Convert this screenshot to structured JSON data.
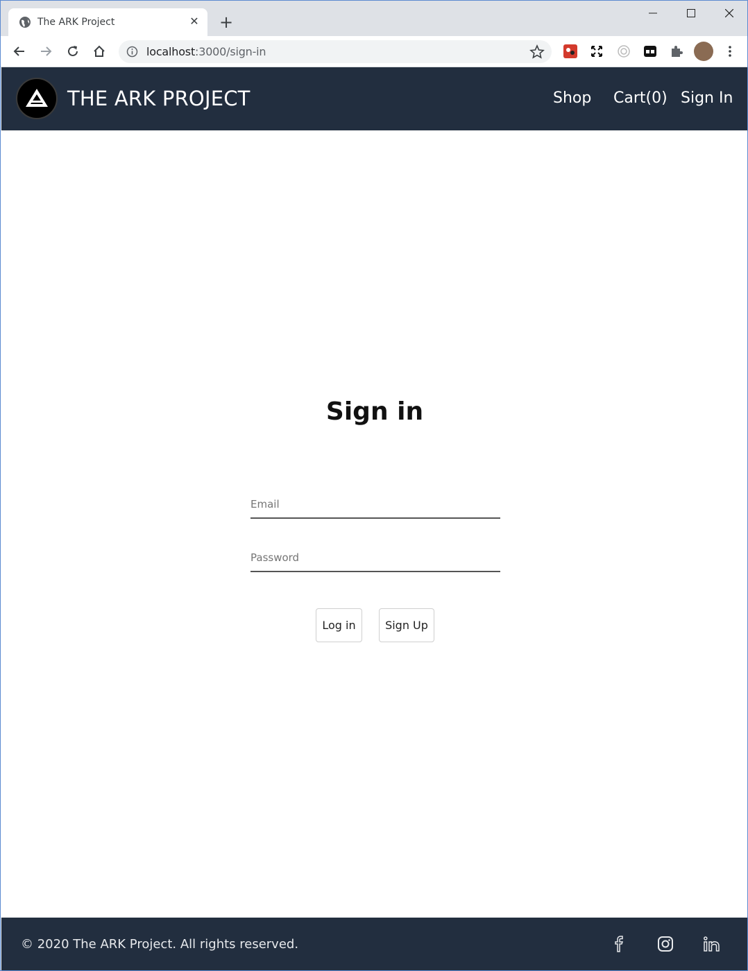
{
  "browser": {
    "tab_title": "The ARK Project",
    "tab_close": "✕",
    "new_tab": "+",
    "url_host": "localhost",
    "url_path": ":3000/sign-in"
  },
  "header": {
    "brand": "THE ARK PROJECT",
    "nav": {
      "shop": "Shop",
      "cart": "Cart(0)",
      "sign_in": "Sign In"
    }
  },
  "main": {
    "title": "Sign in",
    "email_placeholder": "Email",
    "password_placeholder": "Password",
    "login_label": "Log in",
    "signup_label": "Sign Up"
  },
  "footer": {
    "copyright": "© 2020 The ARK Project. All rights reserved.",
    "social_icons": [
      "facebook-icon",
      "instagram-icon",
      "linkedin-icon"
    ]
  },
  "colors": {
    "header_bg": "#222e3f",
    "footer_bg": "#222e3f",
    "tabstrip_bg": "#dee1e6"
  }
}
